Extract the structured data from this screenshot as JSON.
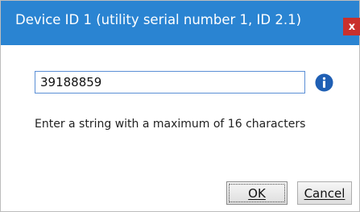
{
  "dialog": {
    "title": "Device ID 1 (utility serial number 1, ID 2.1)",
    "close_icon": "close-icon",
    "close_glyph": "x"
  },
  "field": {
    "value": "39188859",
    "info_icon": "info-icon",
    "hint": "Enter a string with a maximum of 16 characters"
  },
  "buttons": {
    "ok_label": "OK",
    "cancel_label": "Cancel"
  },
  "colors": {
    "title_bar": "#2a84d2",
    "close_button": "#c9302c",
    "input_border": "#5b8fd6",
    "info_icon": "#1f5fb4"
  }
}
